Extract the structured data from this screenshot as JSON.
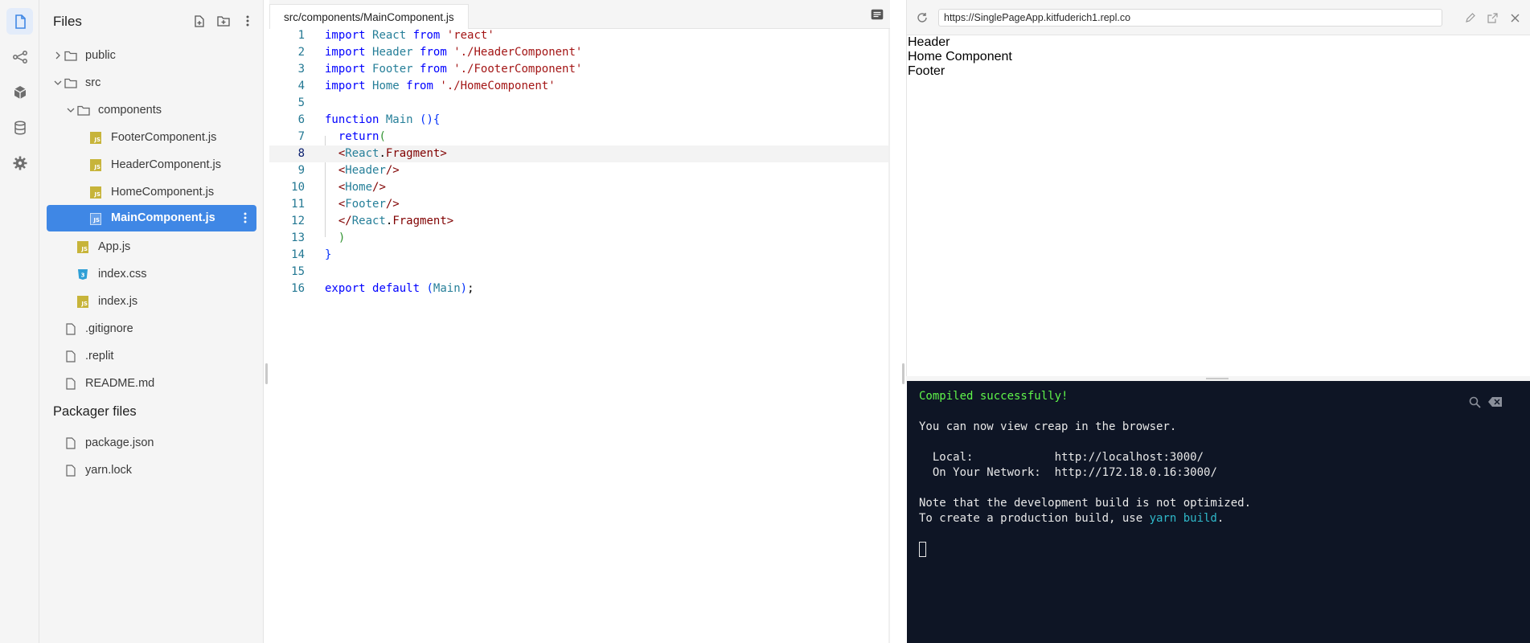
{
  "files_panel": {
    "title": "Files",
    "tree": [
      {
        "label": "public",
        "type": "folder",
        "depth": 0,
        "expanded": false
      },
      {
        "label": "src",
        "type": "folder",
        "depth": 0,
        "expanded": true
      },
      {
        "label": "components",
        "type": "folder",
        "depth": 1,
        "expanded": true
      },
      {
        "label": "FooterComponent.js",
        "type": "js",
        "depth": 2
      },
      {
        "label": "HeaderComponent.js",
        "type": "js",
        "depth": 2
      },
      {
        "label": "HomeComponent.js",
        "type": "js",
        "depth": 2
      },
      {
        "label": "MainComponent.js",
        "type": "js",
        "depth": 2,
        "selected": true
      },
      {
        "label": "App.js",
        "type": "js",
        "depth": 1
      },
      {
        "label": "index.css",
        "type": "css",
        "depth": 1
      },
      {
        "label": "index.js",
        "type": "js",
        "depth": 1
      },
      {
        "label": ".gitignore",
        "type": "file",
        "depth": 0
      },
      {
        "label": ".replit",
        "type": "file",
        "depth": 0
      },
      {
        "label": "README.md",
        "type": "file",
        "depth": 0
      }
    ],
    "packager_title": "Packager files",
    "packager": [
      {
        "label": "package.json",
        "type": "file"
      },
      {
        "label": "yarn.lock",
        "type": "file"
      }
    ]
  },
  "editor": {
    "tab": "src/components/MainComponent.js",
    "current_line": 8,
    "lines": [
      {
        "n": "1",
        "code": "import React from 'react'"
      },
      {
        "n": "2",
        "code": "import Header from './HeaderComponent'"
      },
      {
        "n": "3",
        "code": "import Footer from './FooterComponent'"
      },
      {
        "n": "4",
        "code": "import Home from './HomeComponent'"
      },
      {
        "n": "5",
        "code": ""
      },
      {
        "n": "6",
        "code": "function Main (){"
      },
      {
        "n": "7",
        "code": "  return("
      },
      {
        "n": "8",
        "code": "  <React.Fragment>"
      },
      {
        "n": "9",
        "code": "  <Header/>"
      },
      {
        "n": "10",
        "code": "  <Home/>"
      },
      {
        "n": "11",
        "code": "  <Footer/>"
      },
      {
        "n": "12",
        "code": "  </React.Fragment>"
      },
      {
        "n": "13",
        "code": "  )"
      },
      {
        "n": "14",
        "code": "}"
      },
      {
        "n": "15",
        "code": ""
      },
      {
        "n": "16",
        "code": "export default (Main);"
      }
    ]
  },
  "preview": {
    "url": "https://SinglePageApp.kitfuderich1.repl.co",
    "content": [
      "Header",
      "Home Component",
      "Footer"
    ]
  },
  "console": {
    "compiled": "Compiled successfully!",
    "view_msg": "You can now view creap in the browser.",
    "local_label": "  Local:            ",
    "local_url": "http://localhost:3000/",
    "network_label": "  On Your Network:  ",
    "network_url": "http://172.18.0.16:3000/",
    "note": "Note that the development build is not optimized.",
    "prod_prefix": "To create a production build, use ",
    "prod_cmd": "yarn build",
    "prod_suffix": "."
  },
  "colors": {
    "accent": "#3f87e5",
    "console_bg": "#0e1525",
    "console_success": "#5ff54a"
  }
}
